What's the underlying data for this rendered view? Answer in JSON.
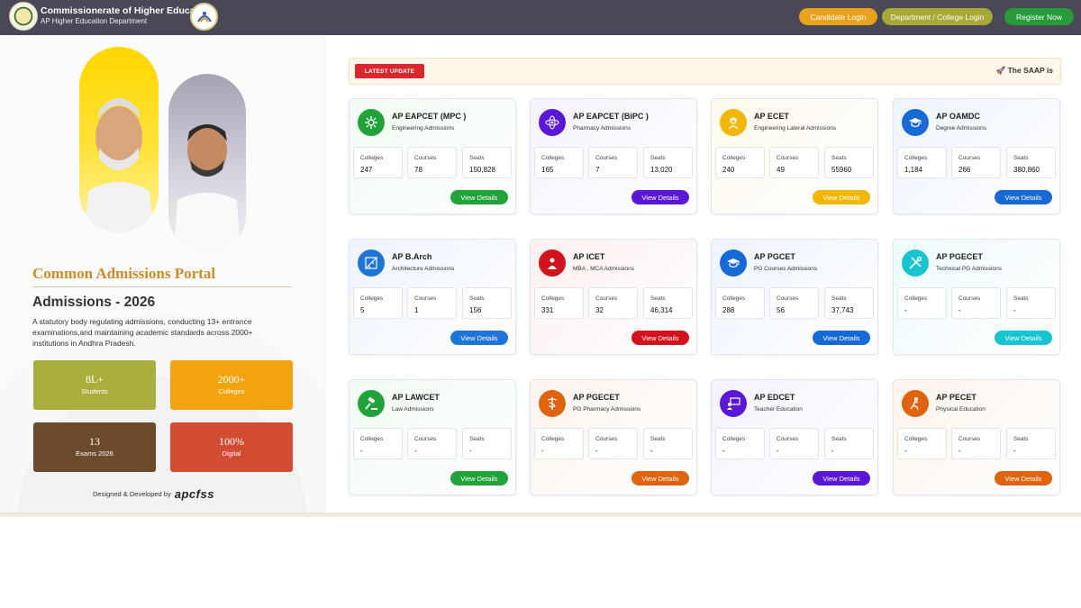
{
  "header": {
    "org_title": "Commissionerate of Higher Education",
    "org_subtitle": "AP Higher Education Department",
    "buttons": {
      "candidate_login": "Candidate Login",
      "dept_login": "Department / College Login",
      "register": "Register Now"
    },
    "colors": {
      "bar": "#4a4757",
      "candidate": "#e8a21c",
      "dept": "#a8a836",
      "register": "#279b3a"
    }
  },
  "hero": {
    "portal_title": "Common Admissions Portal",
    "admissions_title": "Admissions - 2026",
    "description": "A statutory body regulating admissions, conducting 13+ entrance examinations,and maintaining academic standards across 2000+ institutions in Andhra Pradesh.",
    "stats": [
      {
        "value": "8L+",
        "label": "Students",
        "color": "#a9ae3d"
      },
      {
        "value": "2000+",
        "label": "Colleges",
        "color": "#f3a30d"
      },
      {
        "value": "13",
        "label": "Exams 2026",
        "color": "#6e4a2c"
      },
      {
        "value": "100%",
        "label": "Digital",
        "color": "#d24b33"
      }
    ],
    "designed_by": "Designed & Developed by",
    "developer": "apcfss"
  },
  "ticker": {
    "badge": "LATEST UPDATE",
    "text": "🚀 The SAAP is"
  },
  "common": {
    "colleges": "Colleges",
    "courses": "Courses",
    "seats": "Seats",
    "view_details": "View Details"
  },
  "cards": [
    {
      "name": "AP EAPCET (MPC )",
      "sub": "Engineering Admissions",
      "colleges": "247",
      "courses": "78",
      "seats": "150,828",
      "color": "#21a33a",
      "bg": "#f1fbf3",
      "icon": "gear-icon"
    },
    {
      "name": "AP EAPCET (BiPC )",
      "sub": "Pharmacy Admissions",
      "colleges": "165",
      "courses": "7",
      "seats": "13,020",
      "color": "#5a17d6",
      "bg": "#f6f2fe",
      "icon": "atom-icon"
    },
    {
      "name": "AP ECET",
      "sub": "Engineering Lateral Admissions",
      "colleges": "240",
      "courses": "49",
      "seats": "55960",
      "color": "#f2b705",
      "bg": "#fefaed",
      "icon": "worker-icon"
    },
    {
      "name": "AP OAMDC",
      "sub": "Degree Admissions",
      "colleges": "1,184",
      "courses": "266",
      "seats": "380,860",
      "color": "#1769d6",
      "bg": "#eef4fd",
      "icon": "graduation-cap-icon"
    },
    {
      "name": "AP B.Arch",
      "sub": "Architecture Admissions",
      "colleges": "5",
      "courses": "1",
      "seats": "156",
      "color": "#1f74d8",
      "bg": "#eef4fd",
      "icon": "architecture-icon"
    },
    {
      "name": "AP ICET",
      "sub": "MBA , MCA Admissions",
      "colleges": "331",
      "courses": "32",
      "seats": "46,314",
      "color": "#d2121c",
      "bg": "#fdf0f0",
      "icon": "business-icon"
    },
    {
      "name": "AP PGCET",
      "sub": "PG Courses Admissions",
      "colleges": "288",
      "courses": "56",
      "seats": "37,743",
      "color": "#1769d6",
      "bg": "#eef4fd",
      "icon": "graduation-cap-icon"
    },
    {
      "name": "AP PGECET",
      "sub": "Technical PG Admissions",
      "colleges": "-",
      "courses": "-",
      "seats": "-",
      "color": "#19c4d1",
      "bg": "#eefbfc",
      "icon": "tools-icon"
    },
    {
      "name": "AP LAWCET",
      "sub": "Law Admissions",
      "colleges": "-",
      "courses": "-",
      "seats": "-",
      "color": "#21a33a",
      "bg": "#f1fbf3",
      "icon": "gavel-icon"
    },
    {
      "name": "AP PGECET",
      "sub": "PG Pharmacy Admissions",
      "colleges": "-",
      "courses": "-",
      "seats": "-",
      "color": "#e0640f",
      "bg": "#fdf4ec",
      "icon": "caduceus-icon"
    },
    {
      "name": "AP EDCET",
      "sub": "Teacher Education",
      "colleges": "-",
      "courses": "-",
      "seats": "-",
      "color": "#5a17d6",
      "bg": "#f6f2fe",
      "icon": "teacher-icon"
    },
    {
      "name": "AP PECET",
      "sub": "Physical Education",
      "colleges": "-",
      "courses": "-",
      "seats": "-",
      "color": "#e0640f",
      "bg": "#fdf4ec",
      "icon": "sports-icon"
    }
  ]
}
